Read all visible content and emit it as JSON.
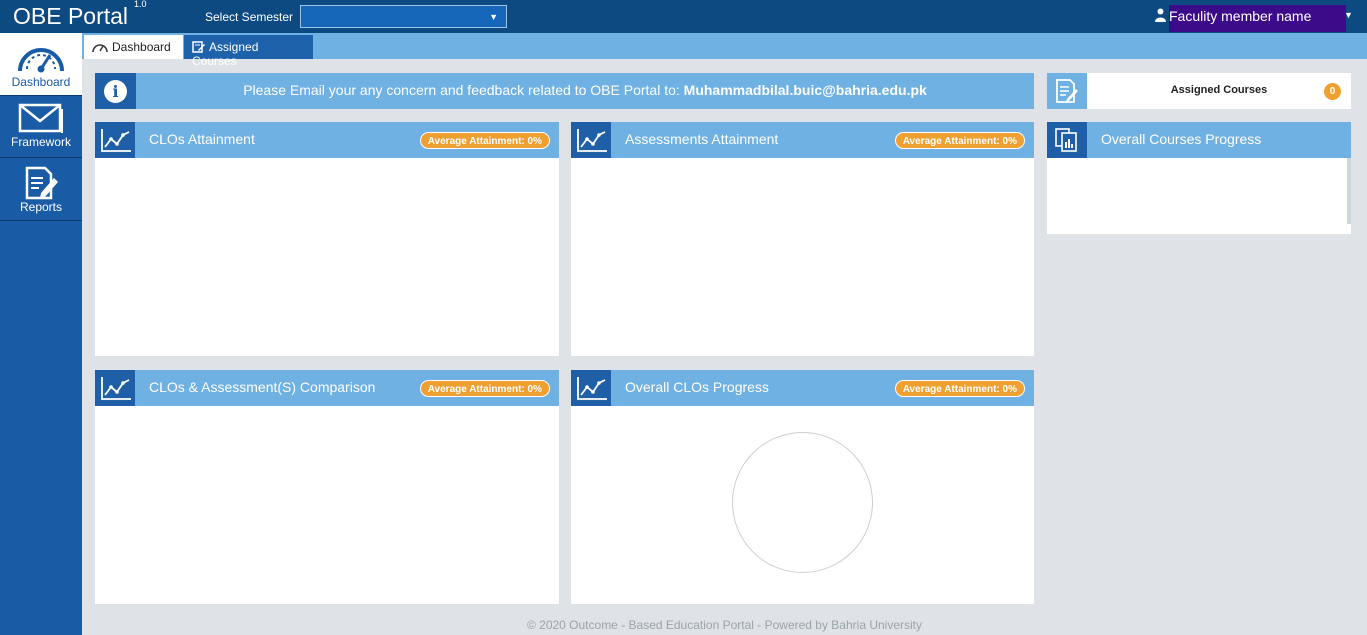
{
  "header": {
    "brand": "OBE Portal",
    "version": "1.0",
    "semester_label": "Select Semester",
    "semester_value": "",
    "user_name": "Faculity member name"
  },
  "sidebar": {
    "items": [
      {
        "label": "Dashboard",
        "icon": "speedometer-icon",
        "active": true
      },
      {
        "label": "Framework",
        "icon": "envelope-icon",
        "active": false
      },
      {
        "label": "Reports",
        "icon": "report-edit-icon",
        "active": false
      }
    ]
  },
  "tabs": [
    {
      "label": "Dashboard",
      "icon": "speedometer-icon",
      "active": true
    },
    {
      "label": "Assigned Courses",
      "icon": "edit-icon",
      "active": false
    }
  ],
  "banner": {
    "message": "Please Email your any concern and feedback related to OBE Portal to: ",
    "email": "Muhammadbilal.buic@bahria.edu.pk"
  },
  "panels": {
    "clos_attainment": {
      "title": "CLOs Attainment",
      "badge": "Average Attainment: 0%"
    },
    "assessments_attainment": {
      "title": "Assessments Attainment",
      "badge": "Average Attainment: 0%"
    },
    "comparison": {
      "title": "CLOs & Assessment(S) Comparison",
      "badge": "Average Attainment: 0%"
    },
    "overall_clos": {
      "title": "Overall CLOs Progress",
      "badge": "Average Attainment: 0%"
    }
  },
  "right": {
    "assigned_label": "Assigned Courses",
    "assigned_count": "0",
    "overall_progress_title": "Overall Courses Progress"
  },
  "footer": "© 2020 Outcome - Based Education Portal - Powered by Bahria University",
  "colors": {
    "topbar": "#0e4a82",
    "sidebar": "#1a5ba6",
    "panel_header": "#6fb1e3",
    "icon_block": "#1e5fa8",
    "badge": "#f0a030"
  }
}
